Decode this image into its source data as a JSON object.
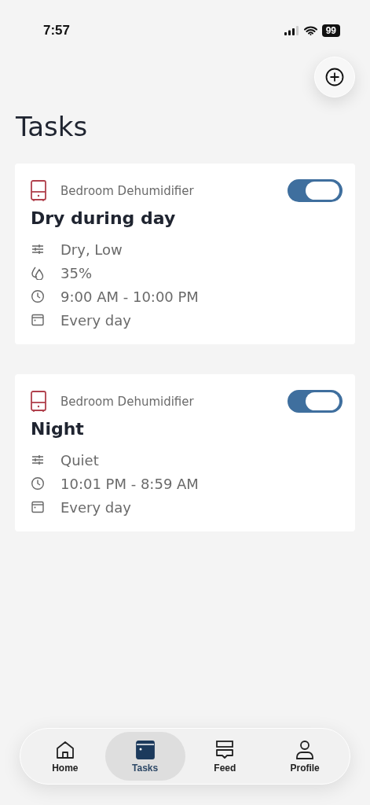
{
  "status_bar": {
    "time": "7:57",
    "battery": "99"
  },
  "title": "Tasks",
  "tasks": [
    {
      "device": "Bedroom Dehumidifier",
      "name": "Dry during day",
      "on": true,
      "details": [
        {
          "kind": "mode",
          "text": "Dry, Low"
        },
        {
          "kind": "humidity",
          "text": "35%"
        },
        {
          "kind": "time",
          "text": "9:00 AM - 10:00 PM"
        },
        {
          "kind": "repeat",
          "text": "Every day"
        }
      ]
    },
    {
      "device": "Bedroom Dehumidifier",
      "name": "Night",
      "on": true,
      "details": [
        {
          "kind": "mode",
          "text": "Quiet"
        },
        {
          "kind": "time",
          "text": "10:01 PM - 8:59 AM"
        },
        {
          "kind": "repeat",
          "text": "Every day"
        }
      ]
    }
  ],
  "nav": [
    {
      "kind": "home",
      "label": "Home",
      "selected": false
    },
    {
      "kind": "tasks",
      "label": "Tasks",
      "selected": true
    },
    {
      "kind": "feed",
      "label": "Feed",
      "selected": false
    },
    {
      "kind": "profile",
      "label": "Profile",
      "selected": false
    }
  ]
}
